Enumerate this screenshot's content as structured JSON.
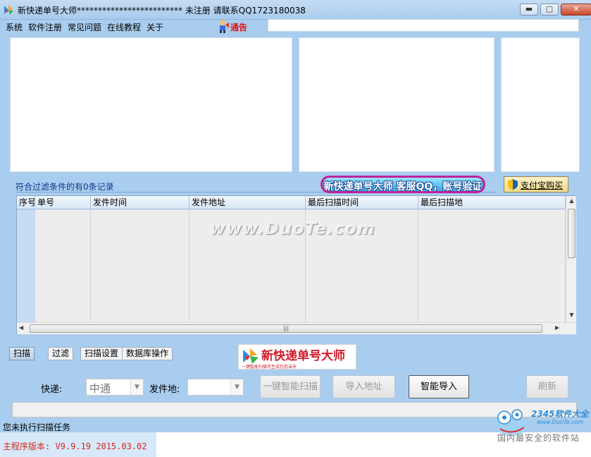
{
  "window": {
    "title": "新快递单号大师*************************  未注册 请联系QQ1723180038",
    "minimize_glyph": "▬",
    "maximize_glyph": "▢",
    "close_glyph": "✕"
  },
  "menu": {
    "items": [
      "系统",
      "软件注册",
      "常见问题",
      "在线教程",
      "关于"
    ],
    "notice_label": "通告",
    "notice_text": ""
  },
  "filter": {
    "count_text": "符合过滤条件的有0条记录"
  },
  "banner": {
    "text": "新快递单号大师 客服QQ，账号验证"
  },
  "alipay": {
    "label": "支付宝购买"
  },
  "table": {
    "columns": [
      "序号",
      "单号",
      "发件时间",
      "发件地址",
      "最后扫描时间",
      "最后扫描地"
    ],
    "rows": [
      [
        "",
        "",
        "",
        "",
        "",
        ""
      ],
      [
        "",
        "",
        "",
        "",
        "",
        ""
      ],
      [
        "",
        "",
        "",
        "",
        "",
        ""
      ],
      [
        "",
        "",
        "",
        "",
        "",
        ""
      ],
      [
        "",
        "",
        "",
        "",
        "",
        ""
      ],
      [
        "",
        "",
        "",
        "",
        "",
        ""
      ],
      [
        "",
        "",
        "",
        "",
        "",
        ""
      ],
      [
        "",
        "",
        "",
        "",
        "",
        ""
      ]
    ]
  },
  "watermark": {
    "text": "www.DuoTe.com"
  },
  "tabs": [
    "扫描",
    "过滤",
    "扫描设置",
    "数据库操作"
  ],
  "logo": {
    "title": "新快递单号大师",
    "subtitle": "一键智能扫描可生成包括当天"
  },
  "scan": {
    "courier_label": "快递:",
    "courier_value": "中通",
    "origin_label": "发件地:",
    "origin_value": "",
    "btn_one_click": "一键智能扫描",
    "btn_import_address": "导入地址",
    "btn_smart_import": "智能导入",
    "btn_refresh": "刷新"
  },
  "status": {
    "message": "您未执行扫描任务",
    "version": "主程序版本: V9.9.19 2015.03.02"
  },
  "site": {
    "logo_num": "2345软件大全",
    "logo_url": "www.DuoTe.com",
    "tagline": "国内最安全的软件站"
  },
  "colors": {
    "window_bg": "#a9cdee",
    "banner_border": "#c0219b",
    "version_text": "#d8281c",
    "logo_text": "#d01c2b"
  }
}
